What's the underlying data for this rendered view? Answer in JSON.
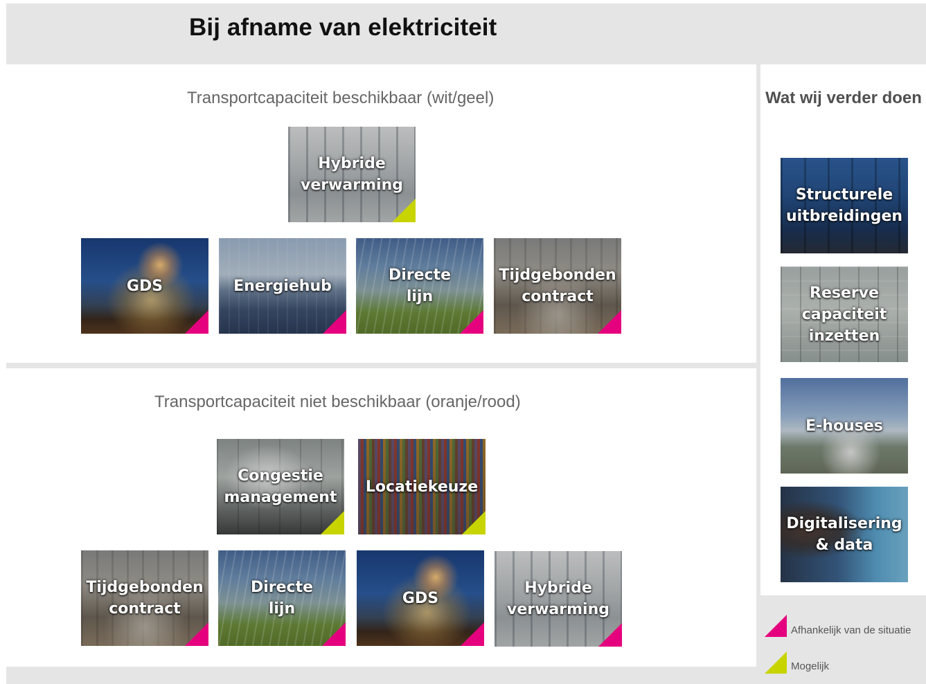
{
  "title": "Bij afname van elektriciteit",
  "section_available": {
    "heading": "Transportcapaciteit beschikbaar (wit/geel)",
    "tiles": [
      {
        "label": "Hybride\nverwarming",
        "corner": "yellow"
      },
      {
        "label": "GDS",
        "corner": "magenta"
      },
      {
        "label": "Energiehub",
        "corner": "magenta"
      },
      {
        "label": "Directe\nlijn",
        "corner": "magenta"
      },
      {
        "label": "Tijdgebonden\ncontract",
        "corner": "magenta"
      }
    ]
  },
  "section_unavailable": {
    "heading": "Transportcapaciteit niet beschikbaar (oranje/rood)",
    "tiles": [
      {
        "label": "Congestie\nmanagement",
        "corner": "yellow"
      },
      {
        "label": "Locatiekeuze",
        "corner": "yellow"
      },
      {
        "label": "Tijdgebonden\ncontract",
        "corner": "magenta"
      },
      {
        "label": "Directe\nlijn",
        "corner": "magenta"
      },
      {
        "label": "GDS",
        "corner": "magenta"
      },
      {
        "label": "Hybride\nverwarming",
        "corner": "magenta"
      }
    ]
  },
  "sidebar": {
    "title": "Wat wij verder doen",
    "tiles": [
      {
        "label": "Structurele\nuitbreidingen"
      },
      {
        "label": "Reserve\ncapaciteit\ninzetten"
      },
      {
        "label": "E-houses"
      },
      {
        "label": "Digitalisering\n& data"
      }
    ]
  },
  "legend": {
    "magenta": "Afhankelijk van de situatie",
    "yellow": "Mogelijk"
  },
  "colors": {
    "magenta": "#e5007e",
    "yellow": "#c8d400",
    "band_grey": "#e6e5e5"
  }
}
